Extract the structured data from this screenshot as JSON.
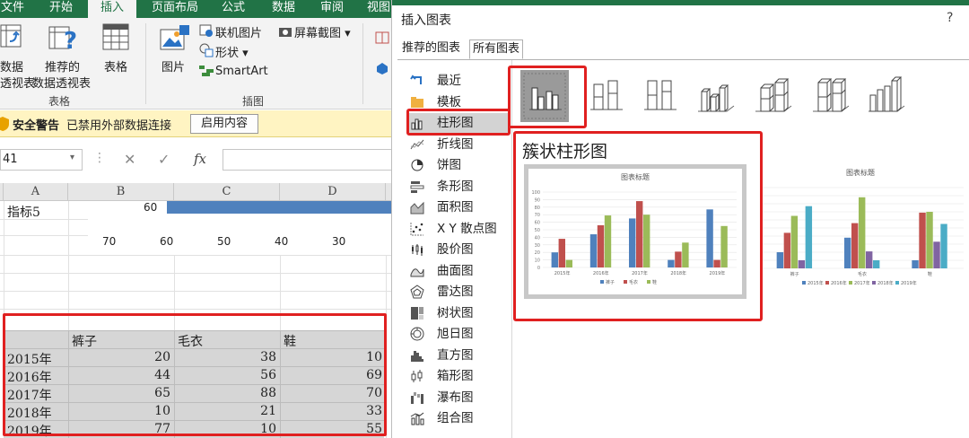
{
  "ribbon": {
    "tabs": [
      "文件",
      "开始",
      "插入",
      "页面布局",
      "公式",
      "数据",
      "审阅",
      "视图"
    ],
    "active_tab": "插入",
    "btn_pivot": [
      "数据",
      "透视表"
    ],
    "btn_recpivot": [
      "推荐的",
      "数据透视表"
    ],
    "btn_table": "表格",
    "group_tables": "表格",
    "btn_picture": "图片",
    "btn_online_picture": "联机图片",
    "btn_shapes": "形状",
    "btn_smartart": "SmartArt",
    "btn_screenshot": "屏幕截图",
    "group_illustrations": "插图"
  },
  "security": {
    "title": "安全警告",
    "message": "已禁用外部数据连接",
    "button": "启用内容"
  },
  "formula": {
    "namebox": "41",
    "fx": "fx",
    "cancel": "✕",
    "confirm": "✓"
  },
  "sheet": {
    "columns": [
      "A",
      "B",
      "C",
      "D"
    ],
    "top_label": "指标5",
    "top_value": "60",
    "axis_ticks": [
      "70",
      "60",
      "50",
      "40",
      "30"
    ],
    "table_headers": [
      "",
      "裤子",
      "毛衣",
      "鞋"
    ],
    "table_rows": [
      {
        "year": "2015年",
        "b": "20",
        "c": "38",
        "d": "10"
      },
      {
        "year": "2016年",
        "b": "44",
        "c": "56",
        "d": "69"
      },
      {
        "year": "2017年",
        "b": "65",
        "c": "88",
        "d": "70"
      },
      {
        "year": "2018年",
        "b": "10",
        "c": "21",
        "d": "33"
      },
      {
        "year": "2019年",
        "b": "77",
        "c": "10",
        "d": "55"
      }
    ]
  },
  "dialog": {
    "title": "插入图表",
    "help": "?",
    "tabs": [
      "推荐的图表",
      "所有图表"
    ],
    "active_tab": "所有图表",
    "chart_types": [
      "最近",
      "模板",
      "柱形图",
      "折线图",
      "饼图",
      "条形图",
      "面积图",
      "X Y 散点图",
      "股价图",
      "曲面图",
      "雷达图",
      "树状图",
      "旭日图",
      "直方图",
      "箱形图",
      "瀑布图",
      "组合图"
    ],
    "selected_type": "柱形图",
    "selected_subtype_name": "簇状柱形图",
    "preview1": {
      "title": "图表标题",
      "categories": [
        "2015年",
        "2016年",
        "2017年",
        "2018年",
        "2019年"
      ],
      "series": [
        {
          "name": "裤子",
          "values": [
            20,
            44,
            65,
            10,
            77
          ],
          "color": "#4f81bd"
        },
        {
          "name": "毛衣",
          "values": [
            38,
            56,
            88,
            21,
            10
          ],
          "color": "#c0504d"
        },
        {
          "name": "鞋",
          "values": [
            10,
            69,
            70,
            33,
            55
          ],
          "color": "#9bbb59"
        }
      ],
      "yticks": [
        "100",
        "90",
        "80",
        "70",
        "60",
        "50",
        "40",
        "30",
        "20",
        "10",
        "0"
      ]
    },
    "preview2": {
      "title": "图表标题",
      "categories": [
        "裤子",
        "毛衣",
        "鞋"
      ],
      "series": [
        {
          "name": "2015年",
          "values": [
            20,
            38,
            10
          ],
          "color": "#4f81bd"
        },
        {
          "name": "2016年",
          "values": [
            44,
            56,
            69
          ],
          "color": "#c0504d"
        },
        {
          "name": "2017年",
          "values": [
            65,
            88,
            70
          ],
          "color": "#9bbb59"
        },
        {
          "name": "2018年",
          "values": [
            10,
            21,
            33
          ],
          "color": "#8064a2"
        },
        {
          "name": "2019年",
          "values": [
            77,
            10,
            55
          ],
          "color": "#4bacc6"
        }
      ],
      "yticks": [
        "100",
        "90",
        "80",
        "70",
        "60",
        "50",
        "40",
        "30",
        "20",
        "10",
        "0"
      ]
    }
  }
}
